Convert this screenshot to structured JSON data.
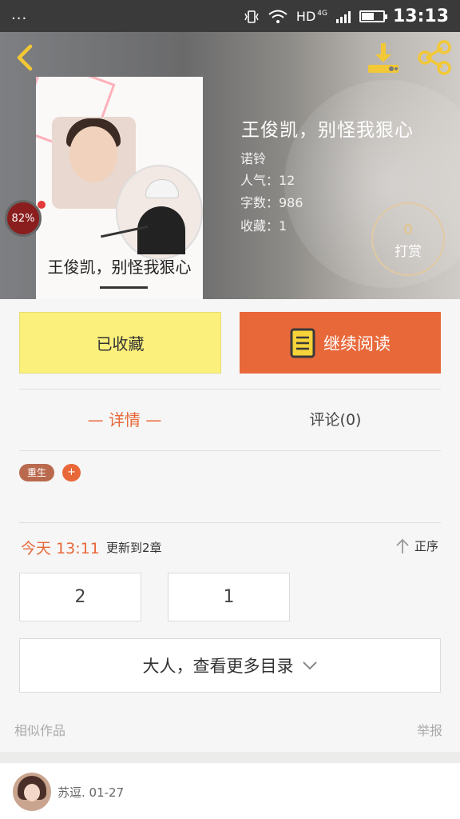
{
  "status_bar": {
    "dots": "...",
    "network": "HD",
    "signal_label": "4G",
    "time": "13:13"
  },
  "book": {
    "title": "王俊凯，别怪我狠心",
    "author": "诺铃",
    "popularity_label": "人气：12",
    "word_count_label": "字数：986",
    "favorites_label": "收藏：1",
    "cover_title": "王俊凯，别怪我狠心",
    "read_progress": "82%"
  },
  "tip": {
    "count": "0",
    "label": "打赏"
  },
  "actions": {
    "collected_label": "已收藏",
    "continue_label": "继续阅读"
  },
  "tabs": {
    "detail": "— 详情 —",
    "comments": "评论(0)"
  },
  "tags": {
    "items": [
      "重生"
    ],
    "add": "+"
  },
  "update": {
    "today": "今天 13:11",
    "chapter": "更新到2章",
    "sort_label": "正序"
  },
  "chapters": [
    "2",
    "1"
  ],
  "more_catalog_label": "大人，查看更多目录",
  "footer": {
    "similar_label": "相似作品",
    "report_label": "举报"
  },
  "comment": {
    "user_date": "苏逗.   01-27"
  },
  "colors": {
    "accent": "#e8683a",
    "collected_bg": "#fbf07b",
    "icon_yellow": "#f3c836",
    "tip_gold": "#e6c27f"
  },
  "icons": {
    "back": "chevron-left-icon",
    "download": "download-icon",
    "share": "share-icon",
    "book": "book-icon",
    "sort": "arrow-up-icon",
    "chevron": "chevron-down-icon"
  }
}
